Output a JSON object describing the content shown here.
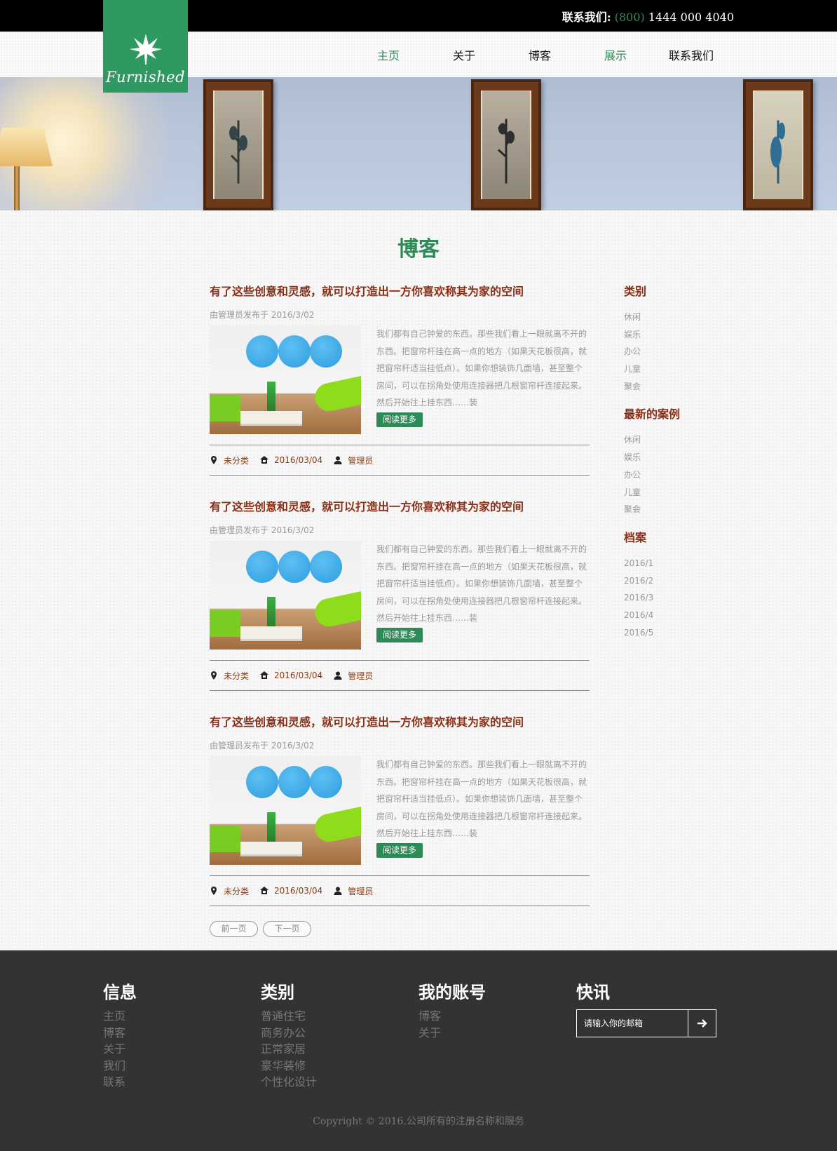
{
  "contact": {
    "label": "联系我们:",
    "area": "(800)",
    "number": "1444 000 4040"
  },
  "brand": {
    "logo_text": "Furnished"
  },
  "nav": [
    {
      "label": "主页",
      "active": true
    },
    {
      "label": "关于",
      "active": false
    },
    {
      "label": "博客",
      "active": false
    },
    {
      "label": "展示",
      "active": true
    },
    {
      "label": "联系我们",
      "active": false
    }
  ],
  "page": {
    "title": "博客"
  },
  "posts": [
    {
      "title": "有了这些创意和灵感，就可以打造出一方你喜欢称其为家的空间",
      "byline": "由管理员发布于 2016/3/02",
      "excerpt": "我们都有自己钟爱的东西。那些我们看上一眼就离不开的东西。把窗帘杆挂在高一点的地方（如果天花板很高，就把窗帘杆适当挂低点）。如果你想装饰几面墙，甚至整个房间，可以在拐角处使用连接器把几根窗帘杆连接起来。然后开始往上挂东西……装",
      "read_more": "阅读更多",
      "category": "未分类",
      "date": "2016/03/04",
      "author": "管理员"
    },
    {
      "title": "有了这些创意和灵感，就可以打造出一方你喜欢称其为家的空间",
      "byline": "由管理员发布于 2016/3/02",
      "excerpt": "我们都有自己钟爱的东西。那些我们看上一眼就离不开的东西。把窗帘杆挂在高一点的地方（如果天花板很高，就把窗帘杆适当挂低点）。如果你想装饰几面墙，甚至整个房间，可以在拐角处使用连接器把几根窗帘杆连接起来。然后开始往上挂东西……装",
      "read_more": "阅读更多",
      "category": "未分类",
      "date": "2016/03/04",
      "author": "管理员"
    },
    {
      "title": "有了这些创意和灵感，就可以打造出一方你喜欢称其为家的空间",
      "byline": "由管理员发布于 2016/3/02",
      "excerpt": "我们都有自己钟爱的东西。那些我们看上一眼就离不开的东西。把窗帘杆挂在高一点的地方（如果天花板很高，就把窗帘杆适当挂低点）。如果你想装饰几面墙，甚至整个房间，可以在拐角处使用连接器把几根窗帘杆连接起来。然后开始往上挂东西……装",
      "read_more": "阅读更多",
      "category": "未分类",
      "date": "2016/03/04",
      "author": "管理员"
    }
  ],
  "pager": {
    "prev": "前一页",
    "next": "下一页"
  },
  "sidebar": {
    "categories_title": "类别",
    "categories": [
      "休闲",
      "娱乐",
      "办公",
      "儿童",
      "聚会"
    ],
    "latest_title": "最新的案例",
    "latest": [
      "休闲",
      "娱乐",
      "办公",
      "儿童",
      "聚会"
    ],
    "archive_title": "档案",
    "archive": [
      "2016/1",
      "2016/2",
      "2016/3",
      "2016/4",
      "2016/5"
    ]
  },
  "footer": {
    "info_title": "信息",
    "info": [
      "主页",
      "博客",
      "关于",
      "我们",
      "联系"
    ],
    "cat_title": "类别",
    "cats": [
      "普通住宅",
      "商务办公",
      "正常家居",
      "豪华装修",
      "个性化设计"
    ],
    "account_title": "我的账号",
    "account": [
      "博客",
      "关于"
    ],
    "news_title": "快讯",
    "email_placeholder": "请输入你的邮箱",
    "copyright": "Copyright © 2016.公司所有的注册名称和服务"
  },
  "colors": {
    "accent": "#2e8b57",
    "title": "#8b2e16",
    "footer_bg": "#333333"
  },
  "icons": {
    "meta": [
      "map-pin-icon",
      "home-icon",
      "user-icon"
    ],
    "subscribe": "arrow-right-icon",
    "logo": "leaf-icon"
  }
}
